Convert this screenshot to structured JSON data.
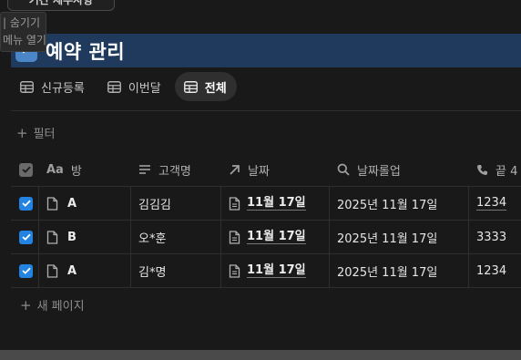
{
  "top_button": {
    "label": "기간 세부사항"
  },
  "tooltip": {
    "lines": [
      "| 숨기기",
      "메뉴 열기"
    ]
  },
  "database": {
    "icon": "↩",
    "title": "예약 관리"
  },
  "tabs": [
    {
      "label": "신규등록",
      "icon": "table-icon",
      "active": false
    },
    {
      "label": "이번달",
      "icon": "table-icon",
      "active": false
    },
    {
      "label": "전체",
      "icon": "table-icon",
      "active": true
    }
  ],
  "filter": {
    "label": "필터"
  },
  "table": {
    "columns": [
      {
        "label": "방",
        "icon": "Aa"
      },
      {
        "label": "고객명",
        "icon": "text-lines-icon"
      },
      {
        "label": "날짜",
        "icon": "arrow-up-right-icon"
      },
      {
        "label": "날짜롤업",
        "icon": "search-icon"
      },
      {
        "label": "끝 4",
        "icon": "phone-icon"
      }
    ],
    "rows": [
      {
        "room": "A",
        "customer": "김김김",
        "date": "11월 17일",
        "rollup": "2025년 11월 17일",
        "phone": "1234"
      },
      {
        "room": "B",
        "customer": "오*훈",
        "date": "11월 17일",
        "rollup": "2025년 11월 17일",
        "phone": "3333"
      },
      {
        "room": "A",
        "customer": "김*명",
        "date": "11월 17일",
        "rollup": "2025년 11월 17일",
        "phone": "1234"
      }
    ]
  },
  "new_page": {
    "label": "새 페이지"
  },
  "colors": {
    "accent": "#2383e2",
    "banner": "#1f3a5c",
    "background": "#191919"
  }
}
